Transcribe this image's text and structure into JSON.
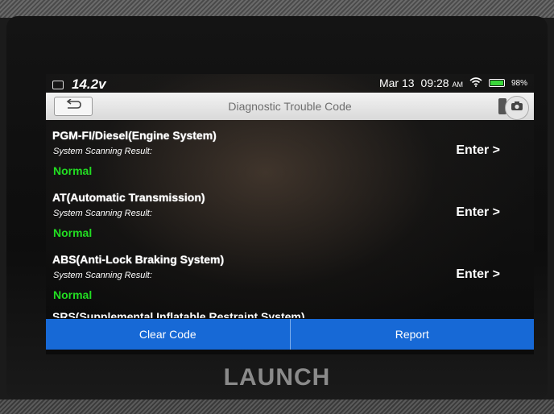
{
  "status_bar": {
    "voltage": "14.2v",
    "date": "Mar 13",
    "time": "09:28",
    "am_pm": "AM",
    "battery_percent": "98%",
    "battery_level": 0.98,
    "icons": [
      "voltage-icon",
      "wifi-icon",
      "battery-icon"
    ]
  },
  "header": {
    "title": "Diagnostic Trouble Code",
    "back_icon": "back-arrow-icon",
    "camera_icon": "camera-icon"
  },
  "systems": [
    {
      "name": "PGM-FI/Diesel(Engine System)",
      "label": "System Scanning Result:",
      "status": "Normal",
      "action": "Enter >"
    },
    {
      "name": "AT(Automatic Transmission)",
      "label": "System Scanning Result:",
      "status": "Normal",
      "action": "Enter >"
    },
    {
      "name": "ABS(Anti-Lock Braking System)",
      "label": "System Scanning Result:",
      "status": "Normal",
      "action": "Enter >"
    }
  ],
  "partial_item": "SRS(Supplemental Inflatable Restraint System)",
  "footer": {
    "clear_code_label": "Clear Code",
    "report_label": "Report"
  },
  "device": {
    "brand": "LAUNCH"
  },
  "colors": {
    "status_ok": "#22dd22",
    "accent_blue": "#1769d6",
    "battery_green": "#3ad63a"
  }
}
